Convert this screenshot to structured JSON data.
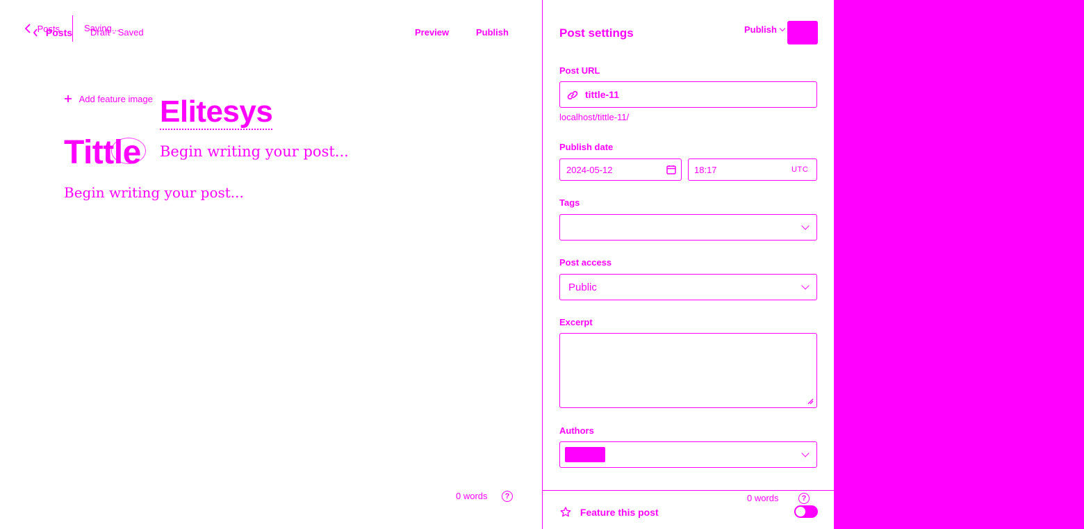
{
  "editor": {
    "topbar": {
      "back_label": "Posts",
      "back_label_ghost": "Posts",
      "status_ghost": "Saving...",
      "status": "Draft - Saved",
      "preview_label": "Preview",
      "publish_label": "Publish"
    },
    "feature_image_label": "Add feature image",
    "title": "Tittle",
    "title_ghost": "Elitesys",
    "body_placeholder": "Begin writing your post...",
    "body_placeholder_ghost": "Begin writing your post...",
    "word_count": "0 words"
  },
  "settings": {
    "title": "Post settings",
    "publish_menu_label": "Publish",
    "post_url_label": "Post URL",
    "post_url_value": "tittle-11",
    "post_url_hint": "localhost/tittle-11/",
    "publish_date_label": "Publish date",
    "publish_date_value": "2024-05-12",
    "publish_time_value": "18:17",
    "timezone": "UTC",
    "tags_label": "Tags",
    "tags_value": "",
    "post_access_label": "Post access",
    "post_access_value": "Public",
    "excerpt_label": "Excerpt",
    "excerpt_value": "",
    "authors_label": "Authors",
    "feature_label": "Feature this post",
    "word_count": "0 words",
    "help_symbol": "?"
  },
  "colors": {
    "accent": "#ff00ff",
    "background": "#ffffff"
  },
  "icons": {
    "back": "chevron-left-icon",
    "plus": "plus-icon",
    "link": "link-icon",
    "calendar": "calendar-icon",
    "chevron": "chevron-down-icon",
    "star": "star-icon",
    "help": "help-circle-icon"
  }
}
